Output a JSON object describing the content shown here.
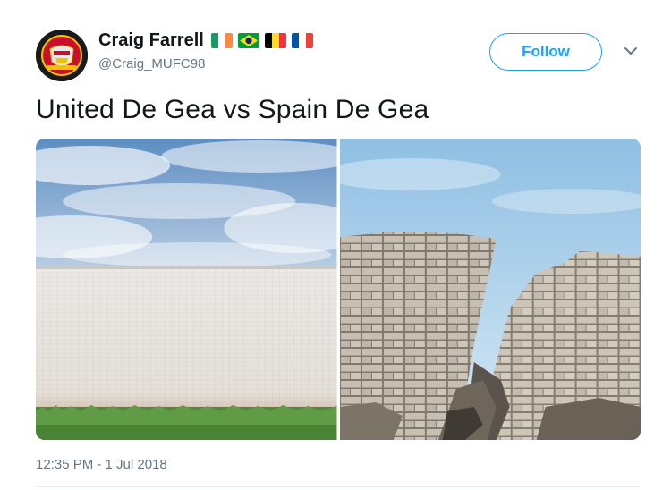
{
  "tweet": {
    "author": {
      "display_name": "Craig Farrell",
      "handle": "@Craig_MUFC98",
      "avatar_icon": "manchester-united-crest-icon",
      "flags": [
        "ireland-flag-icon",
        "brazil-flag-icon",
        "belgium-flag-icon",
        "france-flag-icon"
      ]
    },
    "follow_label": "Follow",
    "text": "United De Gea vs Spain De Gea",
    "media": [
      {
        "description_icon": "intact-wall-photo"
      },
      {
        "description_icon": "broken-wall-photo"
      }
    ],
    "timestamp": "12:35 PM - 1 Jul 2018"
  },
  "colors": {
    "accent": "#1da1f2",
    "secondary_text": "#657786",
    "primary_text": "#14171a"
  }
}
